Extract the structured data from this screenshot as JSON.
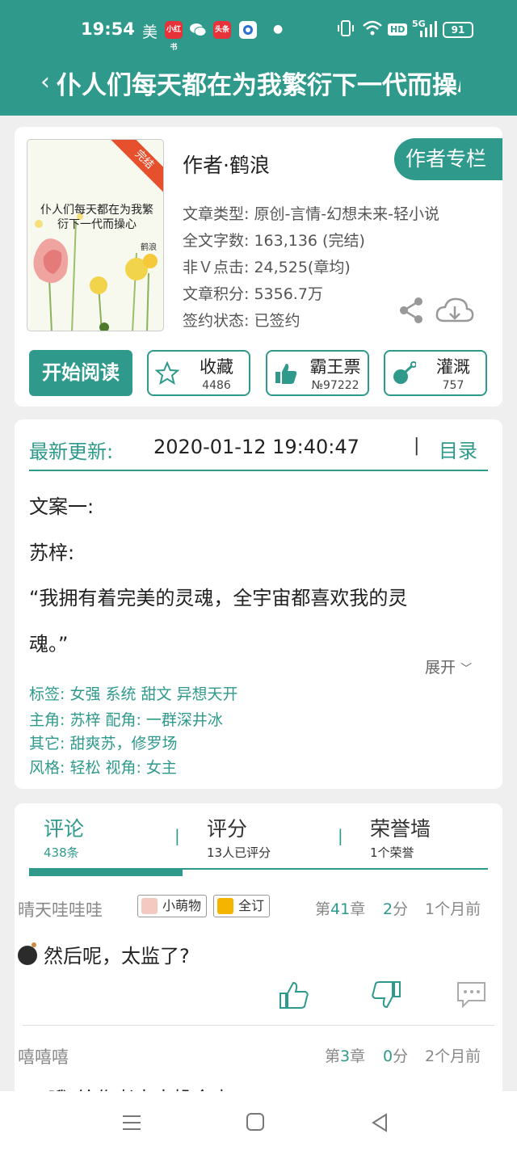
{
  "status": {
    "time": "19:54",
    "carrier_label": "美",
    "apps": [
      "小红书",
      "微信",
      "头条",
      "浏览器"
    ],
    "network": "5G",
    "hd": "HD",
    "battery": "91"
  },
  "header": {
    "back_icon": "chevron-left-icon",
    "title": "仆人们每天都在为我繁衍下一代而操心"
  },
  "book": {
    "cover": {
      "title": "仆人们每天都在为我繁衍下一代而操心",
      "author": "鹤浪",
      "ribbon": "完结"
    },
    "author": "作者·鹤浪",
    "author_column_label": "作者专栏",
    "meta": [
      "文章类型: 原创-言情-幻想未来-轻小说",
      "全文字数: 163,136 (完结)",
      "非Ｖ点击: 24,525(章均)",
      "文章积分: 5356.7万",
      "签约状态:  已签约"
    ],
    "start_reading": "开始阅读",
    "actions": [
      {
        "label": "收藏",
        "sub": "4486",
        "icon": "star-icon"
      },
      {
        "label": "霸王票",
        "sub": "№97222",
        "icon": "thumbs-up-icon"
      },
      {
        "label": "灌溉",
        "sub": "757",
        "icon": "watering-can-icon"
      }
    ]
  },
  "update": {
    "label": "最新更新:",
    "time": "2020-01-12 19:40:47",
    "separator": "|",
    "catalog": "目录"
  },
  "synopsis": {
    "lines": [
      "文案一:",
      "苏梓:",
      "“我拥有着完美的灵魂，全宇宙都喜欢我的灵",
      "魂。”"
    ],
    "expand": "展开"
  },
  "tags": [
    "标签:  女强  系统  甜文  异想天开",
    "主角:  苏梓          配角:  一群深井冰",
    "其它:  甜爽苏，修罗场",
    "风格:  轻松          视角:  女主"
  ],
  "tabs": [
    {
      "label": "评论",
      "sub": "438条",
      "active": true
    },
    {
      "label": "评分",
      "sub": "13人已评分",
      "active": false
    },
    {
      "label": "荣誉墙",
      "sub": "1个荣誉",
      "active": false
    }
  ],
  "comments": [
    {
      "user": "晴天哇哇哇",
      "badges": [
        {
          "label": "小萌物",
          "icon": "cat-face-icon",
          "color": "#f4c9c0"
        },
        {
          "label": "全订",
          "icon": "crown-icon",
          "color": "#f5b400"
        }
      ],
      "chapter_prefix": "第",
      "chapter": "41",
      "chapter_suffix": "章",
      "score": "2",
      "score_suffix": "分",
      "time": "1个月前",
      "text": "然后呢，太监了?"
    },
    {
      "user": "嘻嘻嘻",
      "badges": [],
      "chapter_prefix": "第",
      "chapter": "3",
      "chapter_suffix": "章",
      "score": "0",
      "score_suffix": "分",
      "time": "2个月前",
      "text": "\"..\"哦\"给作者大大投食中"
    }
  ],
  "colors": {
    "accent": "#2f9a8c",
    "ribbon": "#e6502d"
  },
  "navbar": {
    "icons": [
      "menu-icon",
      "home-square-icon",
      "back-triangle-icon"
    ]
  }
}
